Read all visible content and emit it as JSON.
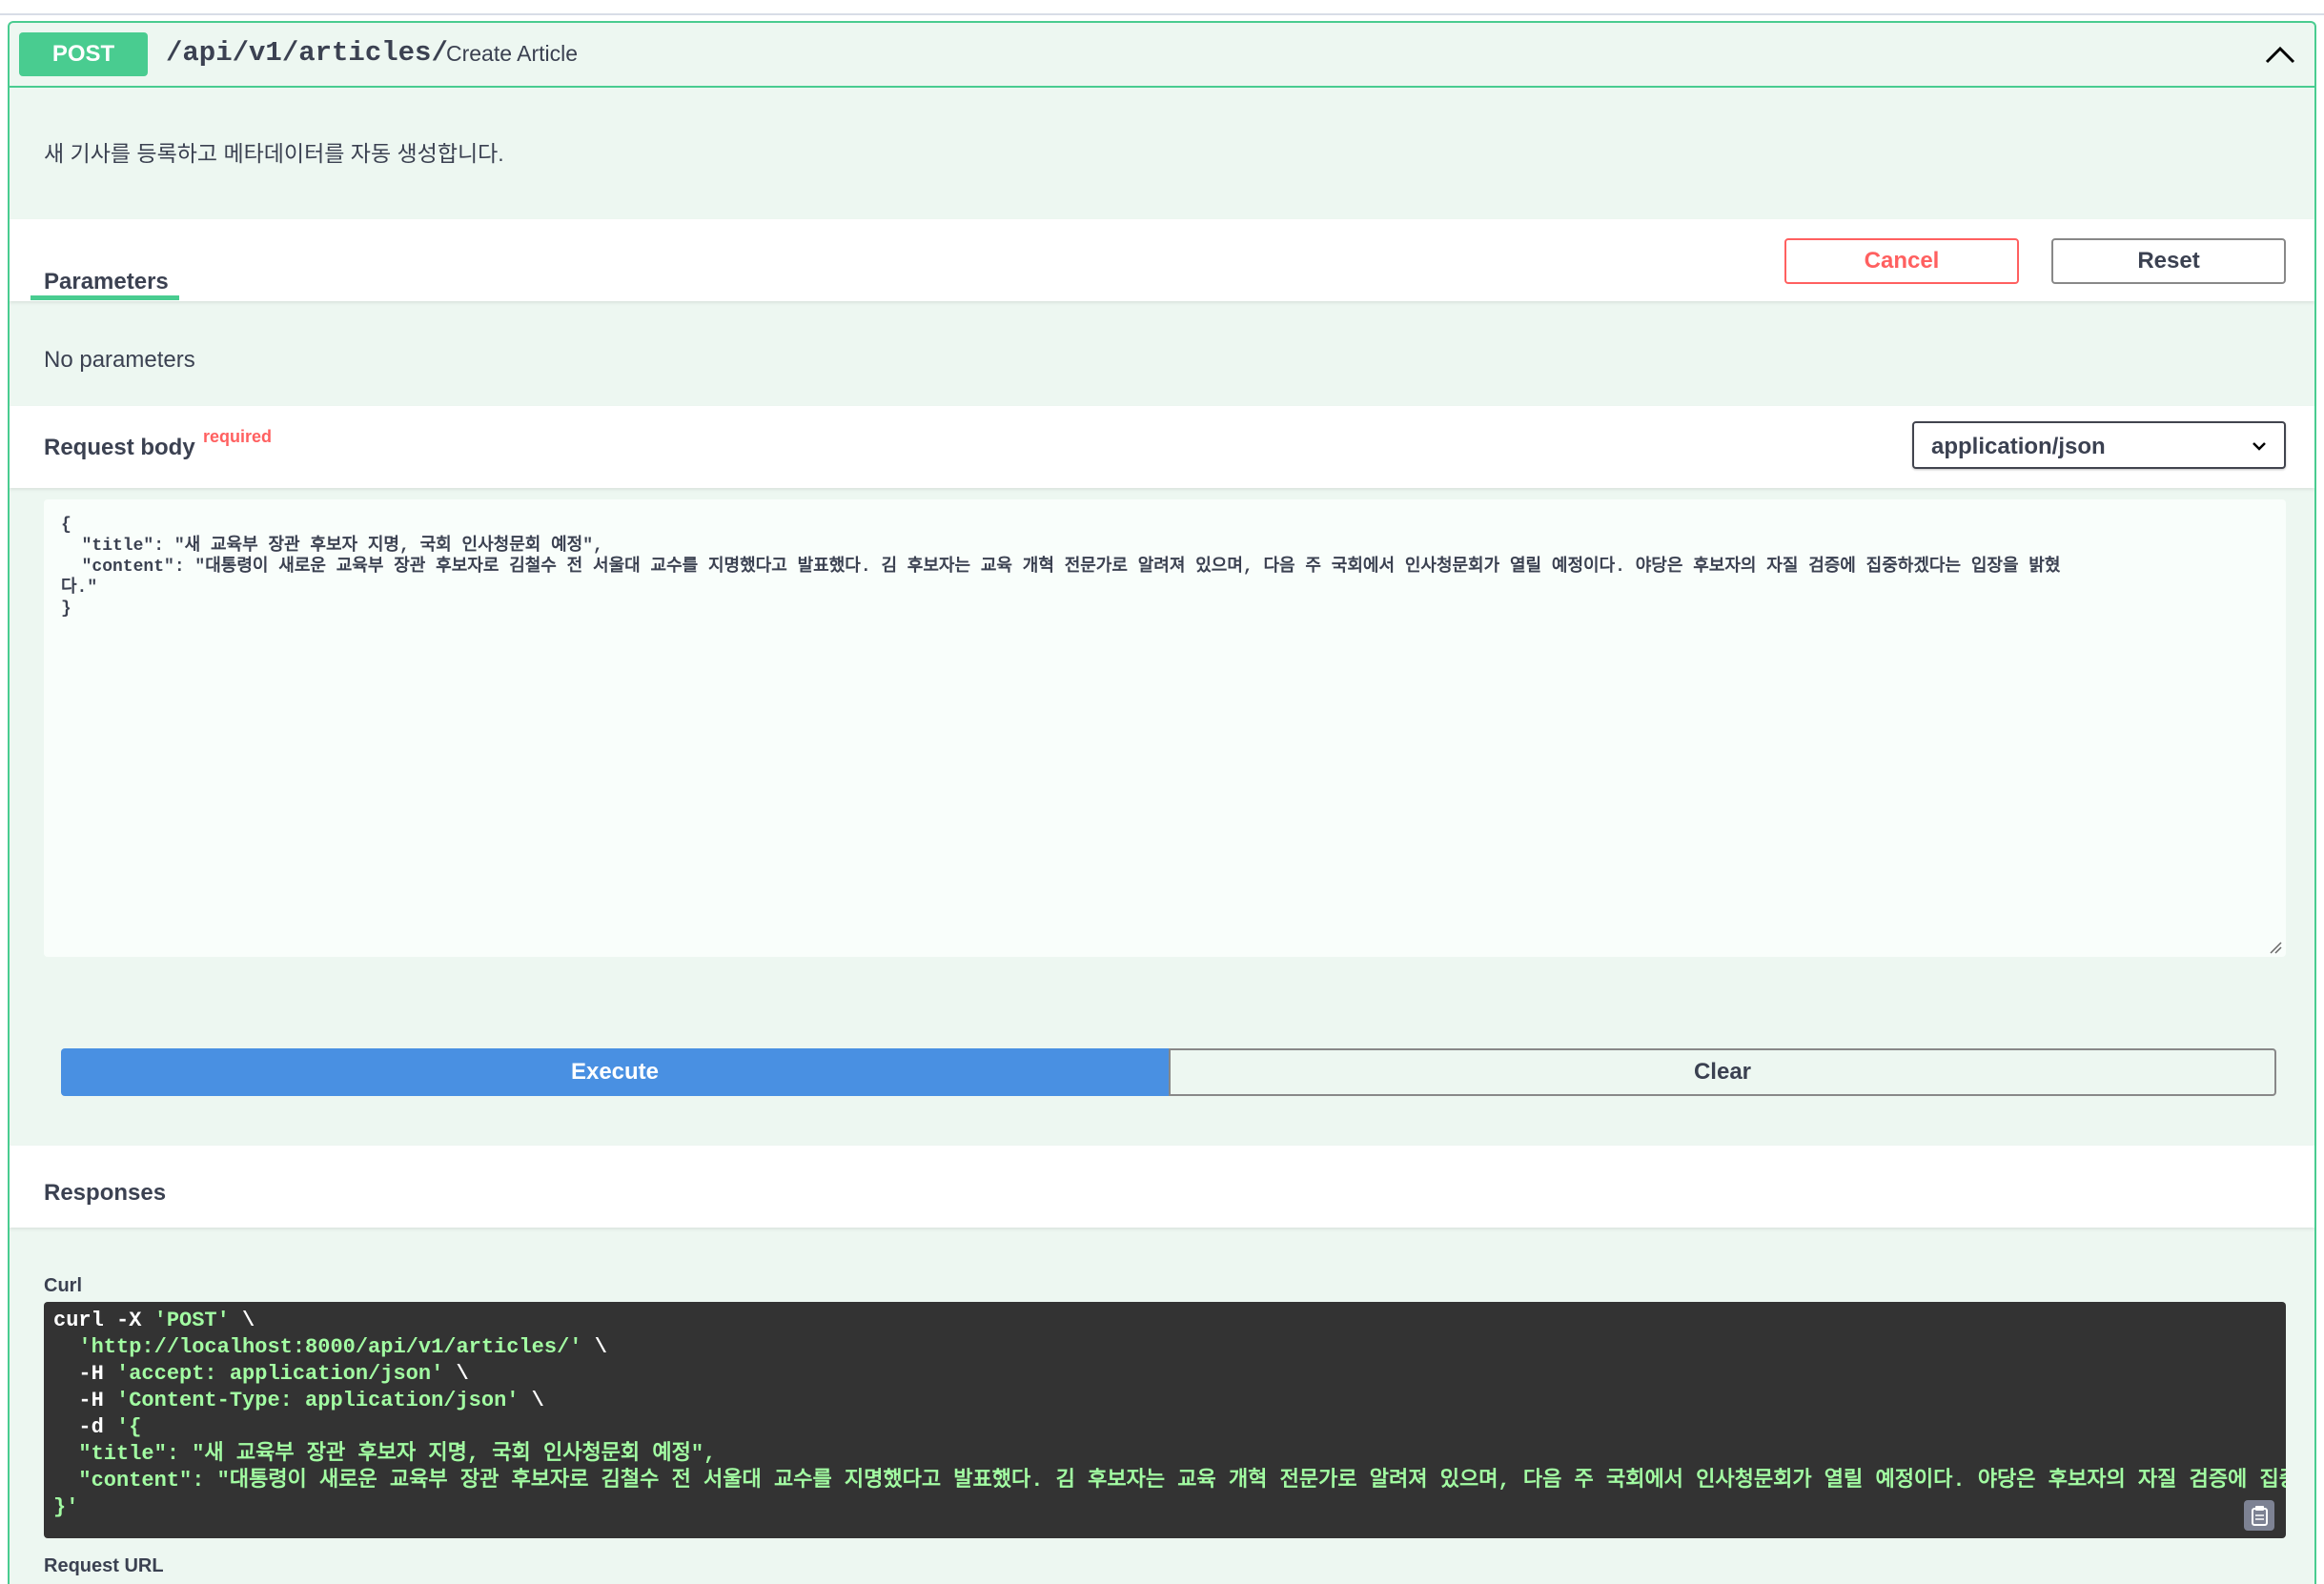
{
  "operation": {
    "method": "POST",
    "path": "/api/v1/articles/",
    "summary": "Create Article",
    "description": "새 기사를 등록하고 메타데이터를 자동 생성합니다."
  },
  "parameters": {
    "tab_label": "Parameters",
    "cancel_label": "Cancel",
    "reset_label": "Reset",
    "empty_text": "No parameters"
  },
  "request_body": {
    "label": "Request body",
    "required_label": "required",
    "content_type": "application/json",
    "lines": [
      "{",
      "  \"title\": \"새 교육부 장관 후보자 지명, 국회 인사청문회 예정\",",
      "  \"content\": \"대통령이 새로운 교육부 장관 후보자로 김철수 전 서울대 교수를 지명했다고 발표했다. 김 후보자는 교육 개혁 전문가로 알려져 있으며, 다음 주 국회에서 인사청문회가 열릴 예정이다. 야당은 후보자의 자질 검증에 집중하겠다는 입장을 밝혔",
      "다.\"",
      "}"
    ]
  },
  "actions": {
    "execute_label": "Execute",
    "clear_label": "Clear"
  },
  "responses": {
    "label": "Responses",
    "curl_label": "Curl",
    "curl_lines": [
      {
        "plain": "curl -X ",
        "green": "'POST'",
        "tail": " \\"
      },
      {
        "plain": "  ",
        "green": "'http://localhost:8000/api/v1/articles/'",
        "tail": " \\"
      },
      {
        "plain": "  -H ",
        "green": "'accept: application/json'",
        "tail": " \\"
      },
      {
        "plain": "  -H ",
        "green": "'Content-Type: application/json'",
        "tail": " \\"
      },
      {
        "plain": "  -d ",
        "green": "'{",
        "tail": ""
      },
      {
        "plain": "  ",
        "green": "\"title\": \"새 교육부 장관 후보자 지명, 국회 인사청문회 예정\",",
        "tail": ""
      },
      {
        "plain": "  ",
        "green": "\"content\": \"대통령이 새로운 교육부 장관 후보자로 김철수 전 서울대 교수를 지명했다고 발표했다. 김 후보자는 교육 개혁 전문가로 알려져 있으며, 다음 주 국회에서 인사청문회가 열릴 예정이다. 야당은 후보자의 자질 검증에 집중하겠다는 입장을 밝",
        "tail": ""
      },
      {
        "plain": "",
        "green": "}'",
        "tail": ""
      }
    ],
    "request_url_label": "Request URL"
  },
  "colors": {
    "post_green": "#49cc90",
    "execute_blue": "#4990e2",
    "cancel_red": "#ff6060",
    "opblock_bg": "#edf7f1"
  },
  "icons": [
    "chevron-up-icon",
    "chevron-down-icon",
    "resize-grip-icon",
    "copy-clipboard-icon"
  ]
}
